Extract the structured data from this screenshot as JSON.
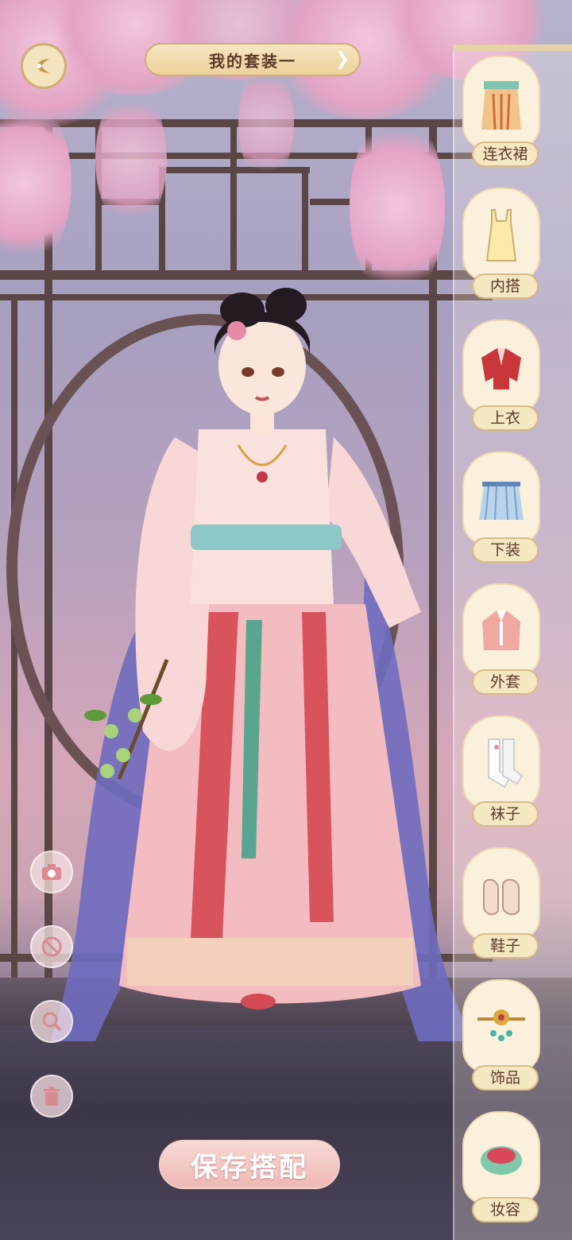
{
  "header": {
    "suit_title": "我的套装一",
    "back_icon": "back-leaf-icon",
    "next_icon": "chevron-right-icon"
  },
  "categories": [
    {
      "label": "连衣裙",
      "icon": "dress-icon"
    },
    {
      "label": "内搭",
      "icon": "inner-wear-icon"
    },
    {
      "label": "上衣",
      "icon": "top-icon"
    },
    {
      "label": "下装",
      "icon": "skirt-icon"
    },
    {
      "label": "外套",
      "icon": "coat-icon"
    },
    {
      "label": "袜子",
      "icon": "socks-icon"
    },
    {
      "label": "鞋子",
      "icon": "shoes-icon"
    },
    {
      "label": "饰品",
      "icon": "accessory-icon"
    },
    {
      "label": "妆容",
      "icon": "makeup-icon"
    }
  ],
  "tools": [
    {
      "icon": "camera-icon"
    },
    {
      "icon": "forbid-icon"
    },
    {
      "icon": "zoom-icon"
    },
    {
      "icon": "trash-icon"
    }
  ],
  "footer": {
    "save_label": "保存搭配"
  },
  "colors": {
    "gold": "#cfae72",
    "cream": "#f6e7c3",
    "save_pink": "#efb8b4",
    "text_brown": "#5b3b2a"
  }
}
